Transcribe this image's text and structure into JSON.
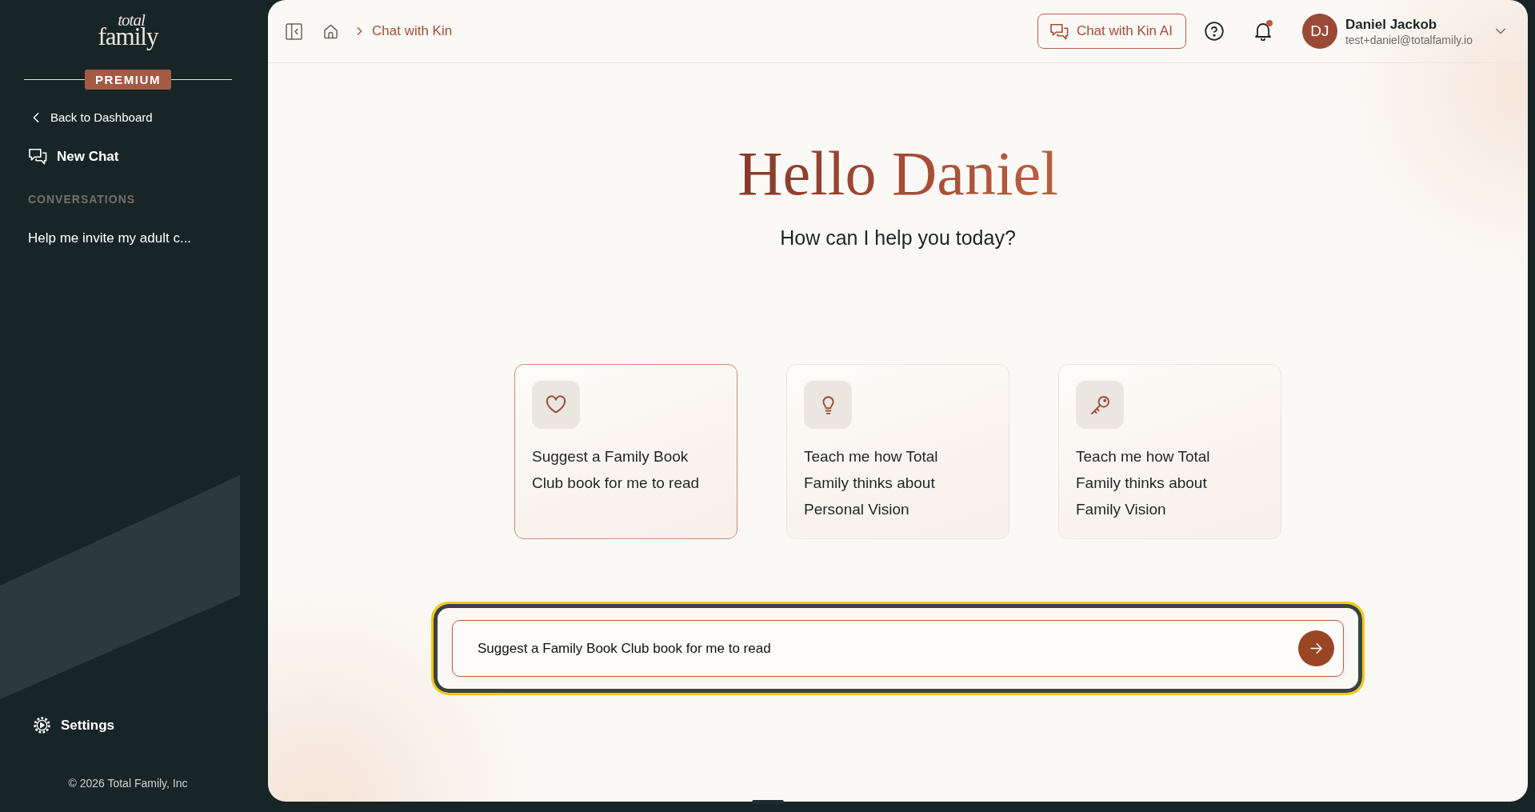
{
  "sidebar": {
    "logo": {
      "top": "total",
      "bottom": "family"
    },
    "plan_badge": "PREMIUM",
    "back_link": "Back to Dashboard",
    "new_chat": "New Chat",
    "section_heading": "CONVERSATIONS",
    "conversations": [
      {
        "title": "Help me invite my adult c...",
        "selected": false
      }
    ],
    "settings": "Settings",
    "footer": "© 2026 Total Family, Inc"
  },
  "header": {
    "breadcrumb": [
      "Chat with Kin"
    ],
    "chat_button": "Chat with Kin AI",
    "notifications": {
      "unread": true
    },
    "user": {
      "initials": "DJ",
      "name": "Daniel Jackob",
      "email": "test+daniel@totalfamily.io"
    }
  },
  "greeting": {
    "title": "Hello Daniel",
    "subtitle": "How can I help you today?"
  },
  "suggestions": [
    {
      "kind": "heart",
      "text": "Suggest a Family Book Club book for me to read",
      "selected": true
    },
    {
      "kind": "lightbulb",
      "text": "Teach me how Total Family thinks about Personal Vision",
      "selected": false
    },
    {
      "kind": "key",
      "text": "Teach me how Total Family thinks about Family Vision",
      "selected": false
    }
  ],
  "composer": {
    "value": "Suggest a Family Book Club book for me to read",
    "focused": true
  }
}
